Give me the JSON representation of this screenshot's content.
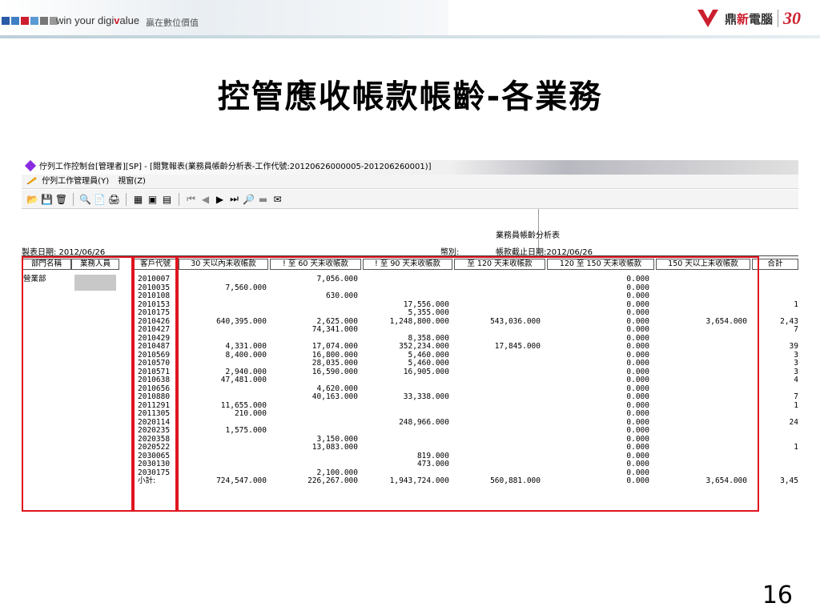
{
  "slide": {
    "brand_text_pre": "win your digi",
    "brand_text_v": "v",
    "brand_text_post": "alue",
    "brand_subtitle": "贏在數位價值",
    "logo_name_a": "鼎",
    "logo_name_b": "新",
    "logo_name_c": "電腦",
    "logo_30": "30",
    "title": "控管應收帳款帳齡-各業務",
    "page_number": "16",
    "colors": {
      "accent_red": "#e0141e",
      "square_colors": [
        "#2a5aa8",
        "#3f7fc4",
        "#cc1f2f",
        "#5a9bd4",
        "#777777",
        "#999999"
      ]
    }
  },
  "window": {
    "title": "佇列工作控制台[管理者][SP] - [閱覽報表(業務員帳齡分析表-工作代號:20120626000005-201206260001)]",
    "menu": [
      "佇列工作管理員(Y)",
      "視窗(Z)"
    ],
    "toolbar_icons": [
      "folder-open-icon",
      "save-icon",
      "trash-icon",
      "find-icon",
      "preview-icon",
      "print-icon",
      "export-icon",
      "export-alt-icon",
      "layout-icon",
      "first-page-icon",
      "prev-page-icon",
      "next-page-icon",
      "last-page-icon",
      "zoom-icon",
      "minus-icon",
      "mail-icon"
    ]
  },
  "report": {
    "title": "業務員帳齡分析表",
    "print_date": "製表日期: 2012/06/26",
    "currency": "幣別:",
    "cutoff": "帳款截止日期:2012/06/26",
    "headers": [
      "部門名稱",
      "業務人員",
      "客戶代號",
      "30 天以內未收帳款",
      "! 至 60 天未收帳款",
      "! 至 90 天未收帳款",
      "至 120 天未收帳款",
      "120 至 150 天未收帳款",
      "150 天以上未收帳款",
      "合計"
    ],
    "department": "營業部",
    "rows": [
      [
        "2010007",
        "",
        "7,056.000",
        "",
        "",
        "0.000",
        "",
        ""
      ],
      [
        "2010035",
        "7,560.000",
        "",
        "",
        "",
        "0.000",
        "",
        ""
      ],
      [
        "2010108",
        "",
        "630.000",
        "",
        "",
        "0.000",
        "",
        ""
      ],
      [
        "2010153",
        "",
        "",
        "17,556.000",
        "",
        "0.000",
        "",
        "1"
      ],
      [
        "2010175",
        "",
        "",
        "5,355.000",
        "",
        "0.000",
        "",
        ""
      ],
      [
        "2010426",
        "640,395.000",
        "2,625.000",
        "1,248,800.000",
        "543,036.000",
        "0.000",
        "3,654.000",
        "2,43"
      ],
      [
        "2010427",
        "",
        "74,341.000",
        "",
        "",
        "0.000",
        "",
        "7"
      ],
      [
        "2010429",
        "",
        "",
        "8,358.000",
        "",
        "0.000",
        "",
        ""
      ],
      [
        "2010487",
        "4,331.000",
        "17,074.000",
        "352,234.000",
        "17,845.000",
        "0.000",
        "",
        "39"
      ],
      [
        "2010569",
        "8,400.000",
        "16,800.000",
        "5,460.000",
        "",
        "0.000",
        "",
        "3"
      ],
      [
        "2010570",
        "",
        "28,035.000",
        "5,460.000",
        "",
        "0.000",
        "",
        "3"
      ],
      [
        "2010571",
        "2,940.000",
        "16,590.000",
        "16,905.000",
        "",
        "0.000",
        "",
        "3"
      ],
      [
        "2010638",
        "47,481.000",
        "",
        "",
        "",
        "0.000",
        "",
        "4"
      ],
      [
        "2010656",
        "",
        "4,620.000",
        "",
        "",
        "0.000",
        "",
        ""
      ],
      [
        "2010880",
        "",
        "40,163.000",
        "33,338.000",
        "",
        "0.000",
        "",
        "7"
      ],
      [
        "2011291",
        "11,655.000",
        "",
        "",
        "",
        "0.000",
        "",
        "1"
      ],
      [
        "2011305",
        "210.000",
        "",
        "",
        "",
        "0.000",
        "",
        ""
      ],
      [
        "2020114",
        "",
        "",
        "248,966.000",
        "",
        "0.000",
        "",
        "24"
      ],
      [
        "2020235",
        "1,575.000",
        "",
        "",
        "",
        "0.000",
        "",
        ""
      ],
      [
        "2020358",
        "",
        "3,150.000",
        "",
        "",
        "0.000",
        "",
        ""
      ],
      [
        "2020522",
        "",
        "13,083.000",
        "",
        "",
        "0.000",
        "",
        "1"
      ],
      [
        "2030065",
        "",
        "",
        "819.000",
        "",
        "0.000",
        "",
        ""
      ],
      [
        "2030130",
        "",
        "",
        "473.000",
        "",
        "0.000",
        "",
        ""
      ],
      [
        "2030175",
        "",
        "2,100.000",
        "",
        "",
        "0.000",
        "",
        ""
      ]
    ],
    "subtotal": [
      "小計:",
      "724,547.000",
      "226,267.000",
      "1,943,724.000",
      "560,881.000",
      "0.000",
      "3,654.000",
      "3,45"
    ]
  }
}
